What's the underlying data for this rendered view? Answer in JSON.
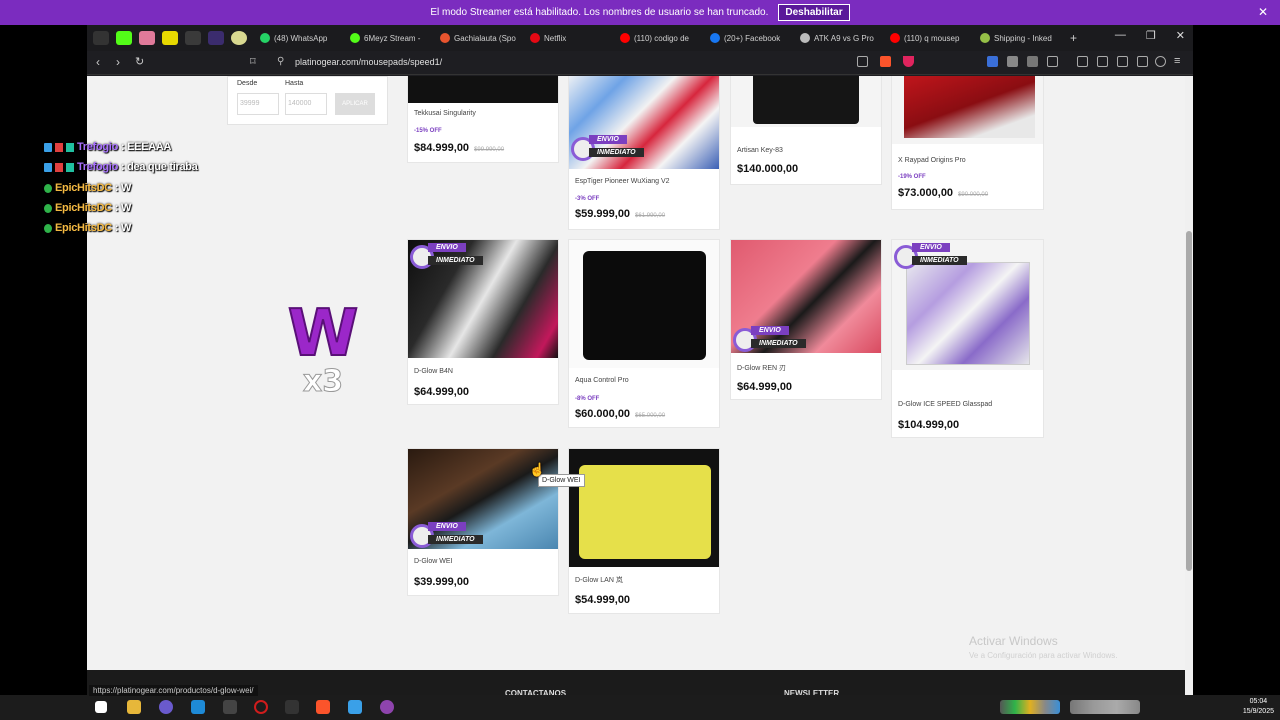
{
  "banner": {
    "text": "El modo Streamer está habilitado. Los nombres de usuario se han truncado.",
    "button": "Deshabilitar",
    "close": "✕"
  },
  "tabs": [
    {
      "label": "(48) WhatsApp",
      "color": "#25d366"
    },
    {
      "label": "6Meyz Stream - ",
      "color": "#53fc18"
    },
    {
      "label": "Gachialauta (Spo",
      "color": "#e8542e"
    },
    {
      "label": "Netflix",
      "color": "#e50914"
    },
    {
      "label": "(110) codigo de ",
      "color": "#ff0000"
    },
    {
      "label": "(20+) Facebook",
      "color": "#1877f2"
    },
    {
      "label": "ATK A9 vs G Pro",
      "color": "#bbbbbb"
    },
    {
      "label": "(110) q mousep",
      "color": "#ff0000"
    },
    {
      "label": "Shipping - Inked",
      "color": "#95bf47"
    }
  ],
  "new_tab": "+",
  "window_controls": {
    "min": "—",
    "max": "❐",
    "close": "✕"
  },
  "address_bar": {
    "url": "platinogear.com/mousepads/speed1/"
  },
  "filter": {
    "from_label": "Desde",
    "to_label": "Hasta",
    "from_placeholder": "39999",
    "to_placeholder": "140000",
    "apply_label": "APLICAR"
  },
  "badge": {
    "line1": "ENVIO",
    "line2": "INMEDIATO"
  },
  "products": [
    {
      "name": "Tekkusai Singularity",
      "discount": "-15% OFF",
      "price": "$84.999,00",
      "old_price": "$99.990,00"
    },
    {
      "name": "EspTiger Pioneer WuXiang V2",
      "discount": "-3% OFF",
      "price": "$59.999,00",
      "old_price": "$61.990,00"
    },
    {
      "name": "Artisan Key-83",
      "discount": "",
      "price": "$140.000,00",
      "old_price": ""
    },
    {
      "name": "X Raypad Origins Pro",
      "discount": "-19% OFF",
      "price": "$73.000,00",
      "old_price": "$90.000,00"
    },
    {
      "name": "D-Glow B4N",
      "discount": "",
      "price": "$64.999,00",
      "old_price": ""
    },
    {
      "name": "Aqua Control Pro",
      "discount": "-8% OFF",
      "price": "$60.000,00",
      "old_price": "$65.000,00"
    },
    {
      "name": "D-Glow REN 刃",
      "discount": "",
      "price": "$64.999,00",
      "old_price": ""
    },
    {
      "name": "D-Glow ICE SPEED Glasspad",
      "discount": "",
      "price": "$104.999,00",
      "old_price": ""
    },
    {
      "name": "D-Glow WEI",
      "discount": "",
      "price": "$39.999,00",
      "old_price": ""
    },
    {
      "name": "D-Glow LAN 岚",
      "discount": "",
      "price": "$54.999,00",
      "old_price": ""
    }
  ],
  "tooltip": "D-Glow WEI",
  "status_url": "https://platinogear.com/productos/d-glow-wei/",
  "footer": {
    "contact": "CONTACTANOS",
    "newsletter": "NEWSLETTER"
  },
  "watermark": {
    "line1": "Activar Windows",
    "line2": "Ve a Configuración para activar Windows."
  },
  "chat": [
    {
      "user": "Trefogio",
      "msg": ": EEEAAA",
      "color": "#a970ff"
    },
    {
      "user": "Trefogio",
      "msg": ": dea que tiraba",
      "color": "#a970ff"
    },
    {
      "user": "EpicHitsDC",
      "msg": ": W",
      "color": "#f4b942"
    },
    {
      "user": "EpicHitsDC",
      "msg": ": W",
      "color": "#f4b942"
    },
    {
      "user": "EpicHitsDC",
      "msg": ": W",
      "color": "#f4b942"
    }
  ],
  "emote": {
    "letter": "W",
    "multiplier": "x3"
  },
  "clock": {
    "time": "05:04",
    "date": "15/9/2025"
  }
}
